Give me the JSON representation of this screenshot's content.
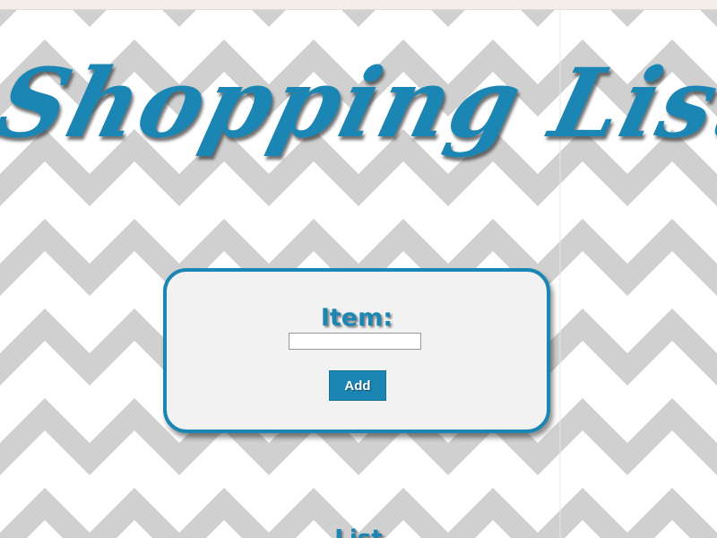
{
  "page": {
    "title": "Shopping List"
  },
  "form": {
    "item_label": "Item:",
    "item_input_value": "",
    "item_input_placeholder": "",
    "add_label": "Add"
  },
  "list": {
    "heading": "List"
  },
  "colors": {
    "accent": "#1b86b3",
    "chevron_gray": "#d0d0d0",
    "chevron_white": "#ffffff",
    "panel_background": "#f2f2f2"
  },
  "background": {
    "pattern": "chevron-zigzag"
  }
}
